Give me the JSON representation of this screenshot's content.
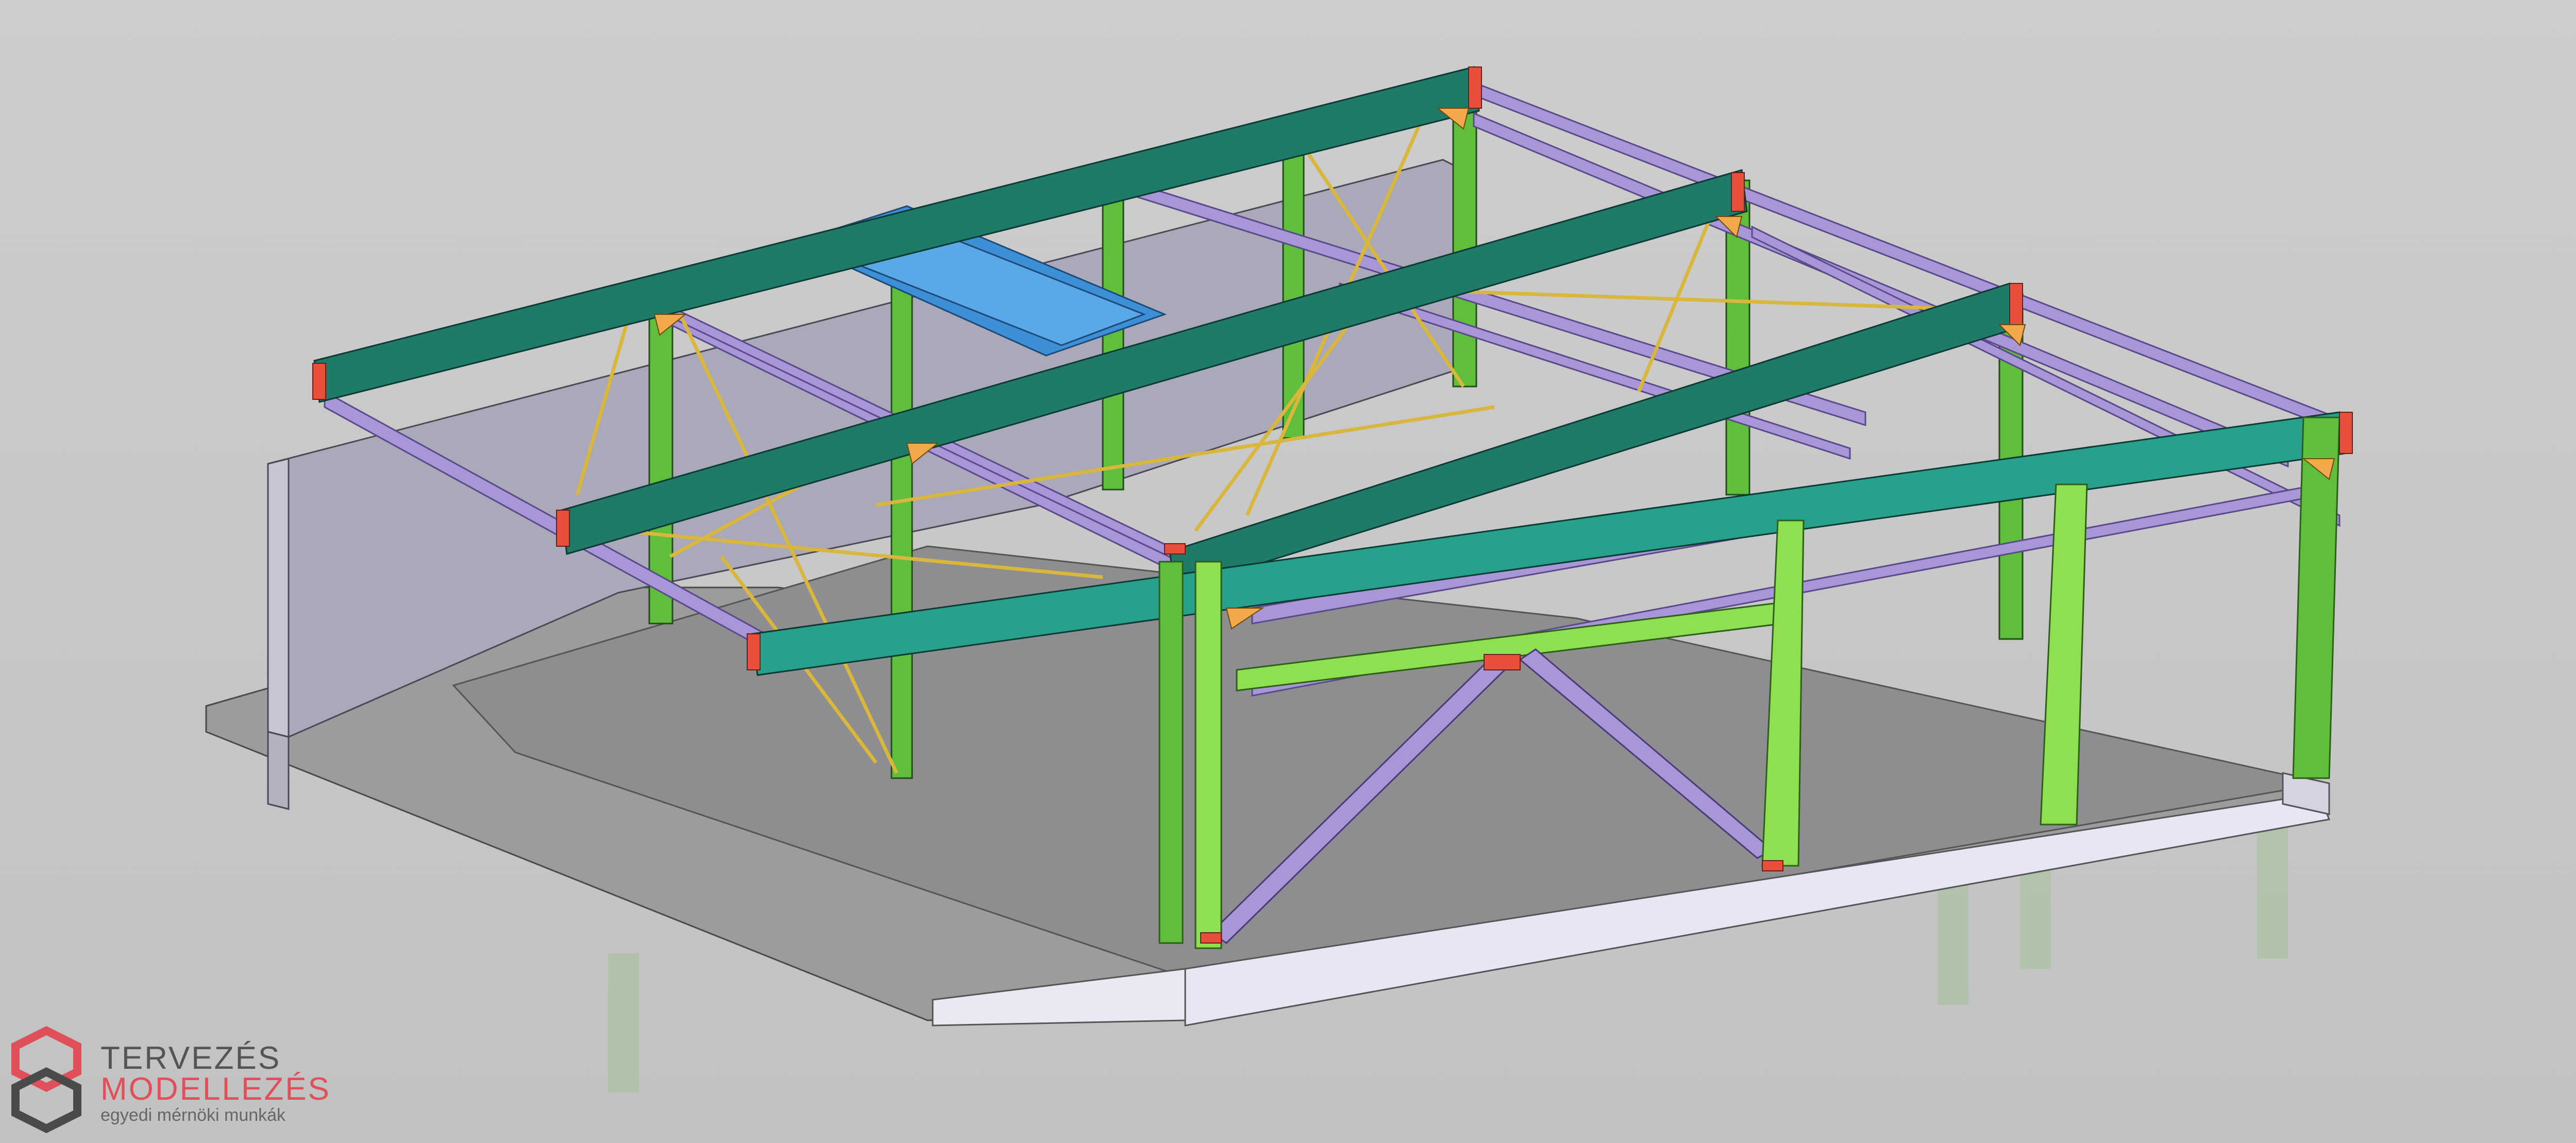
{
  "logo": {
    "line1": "TERVEZÉS",
    "line2": "MODELLEZÉS",
    "tagline": "egyedi mérnöki munkák"
  },
  "colors": {
    "background": "#c9c9c9",
    "rafter": "#1f7a6a",
    "rafter_front": "#27a08c",
    "column": "#5fbf3c",
    "column_front": "#8fe050",
    "purlin": "#a996d6",
    "bracing": "#d9b63c",
    "plate": "#e8503c",
    "haunch": "#f1a94a",
    "skylight_frame": "#3d8fd6",
    "slab": "#8e8e90",
    "wall": "#a9a9b9",
    "logo_red": "#e0505a",
    "logo_gray": "#555555"
  }
}
